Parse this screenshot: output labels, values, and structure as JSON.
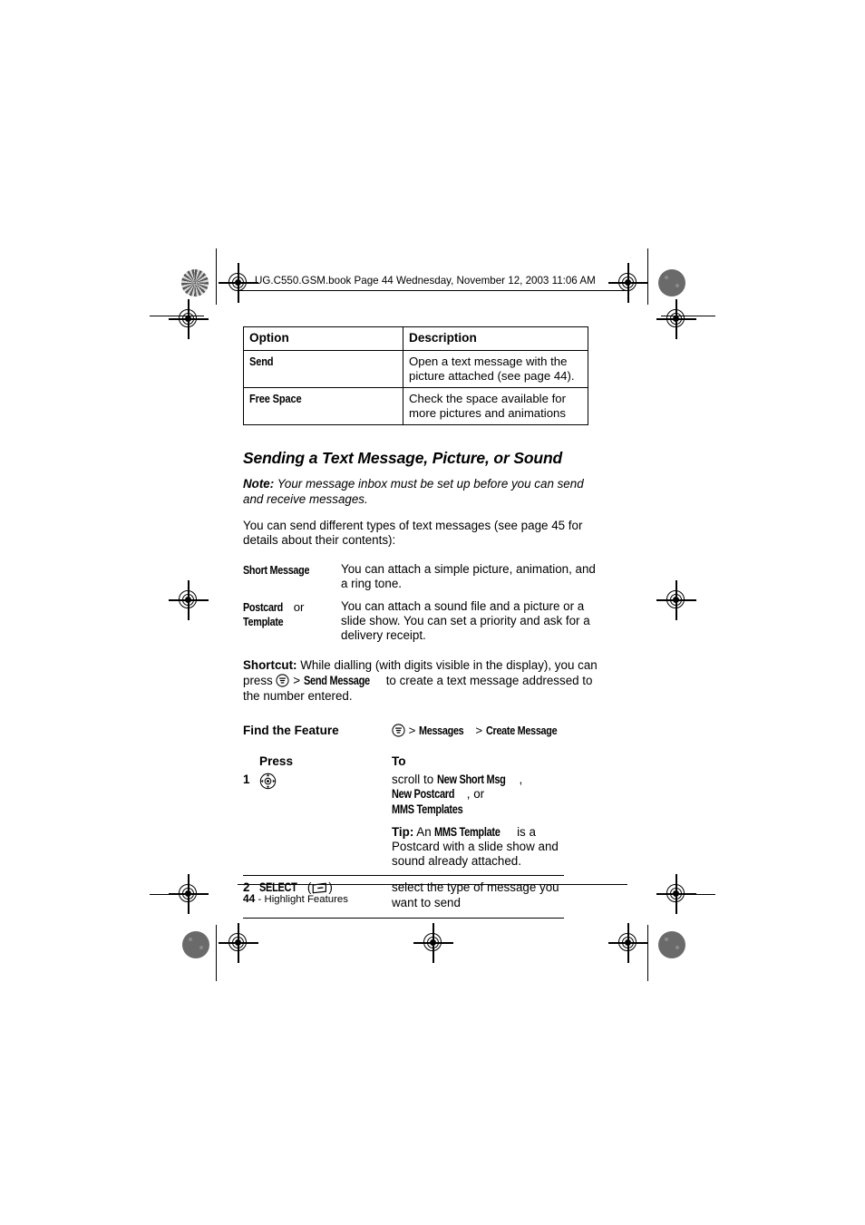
{
  "header": {
    "file_line": "UG.C550.GSM.book  Page 44  Wednesday, November 12, 2003  11:06 AM"
  },
  "option_table": {
    "headers": [
      "Option",
      "Description"
    ],
    "rows": [
      {
        "option": "Send",
        "description": "Open a text message with the picture attached (see page 44)."
      },
      {
        "option": "Free Space",
        "description": "Check the space available for more pictures and animations"
      }
    ]
  },
  "section": {
    "heading": "Sending a Text Message, Picture, or Sound",
    "note_label": "Note:",
    "note_text": " Your message inbox must be set up before you can send and receive messages.",
    "intro": "You can send different types of text messages (see page 45 for details about their contents):"
  },
  "message_types": [
    {
      "term": "Short Message",
      "term_suffix": "",
      "term_line2": "",
      "description": "You can attach a simple picture, animation, and a ring tone."
    },
    {
      "term": "Postcard",
      "term_suffix": " or",
      "term_line2": "Template",
      "description": "You can attach a sound file and a picture or a slide show. You can set a priority and ask for a delivery receipt."
    }
  ],
  "shortcut": {
    "label": "Shortcut:",
    "text_before_icon": " While dialling (with digits visible in the display), you can press ",
    "icon": "menu-key-icon",
    "separator": " > ",
    "menu_item": "Send Message",
    "text_after": " to create a text message addressed to the number entered."
  },
  "find_the_feature": {
    "label": "Find the Feature",
    "icon": "menu-key-icon",
    "sep1": " > ",
    "path1": "Messages",
    "sep2": " > ",
    "path2": "Create Message"
  },
  "steps_table": {
    "headers": [
      "Press",
      "To"
    ],
    "rows": [
      {
        "number": "1",
        "key_icon": "navigation-key-icon",
        "key_label": "",
        "to_prefix": "scroll to ",
        "to_terms": [
          "New Short Msg",
          "New Postcard",
          "MMS Templates"
        ],
        "to_connector1": ",",
        "to_connector2": ", or ",
        "tip_label": "Tip:",
        "tip_before": " An ",
        "tip_term": "MMS Template",
        "tip_after": " is a Postcard with a slide show and sound already attached."
      },
      {
        "number": "2",
        "key_label": "SELECT",
        "key_icon": "soft-key-icon",
        "to_text": "select the type of message you want to send"
      }
    ]
  },
  "footer": {
    "page_number": "44",
    "separator": " - ",
    "chapter": "Highlight Features"
  }
}
